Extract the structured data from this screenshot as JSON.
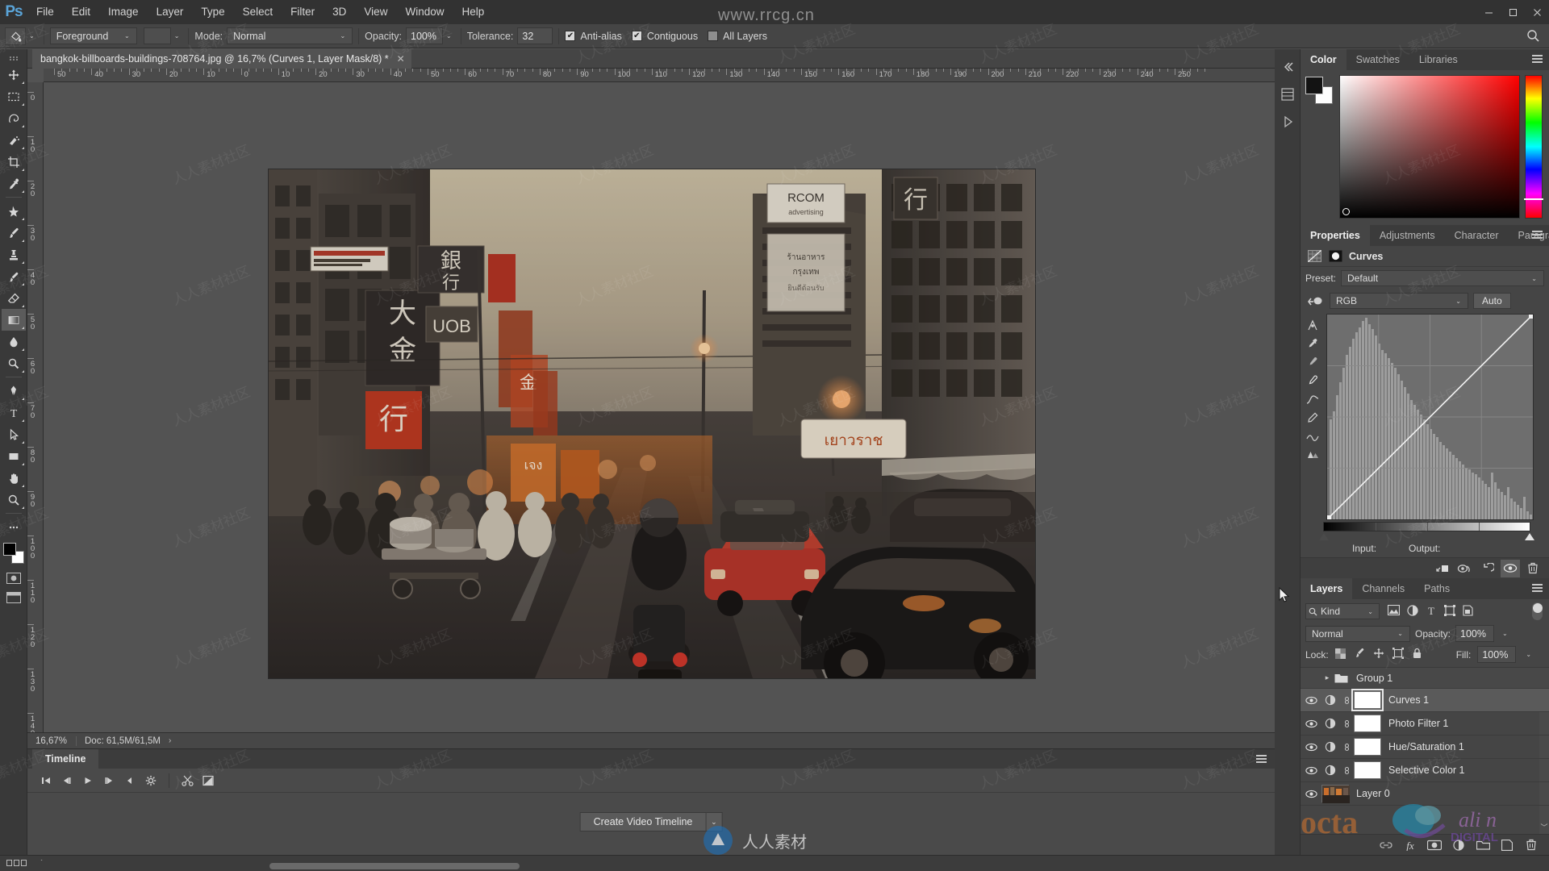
{
  "app": {
    "name": "Adobe Photoshop",
    "logo_text": "Ps"
  },
  "watermark": {
    "top": "www.rrcg.cn",
    "tile": "人人素材社区",
    "bottom": "人人素材"
  },
  "menubar": {
    "items": [
      "File",
      "Edit",
      "Image",
      "Layer",
      "Type",
      "Select",
      "Filter",
      "3D",
      "View",
      "Window",
      "Help"
    ],
    "window_controls": {
      "minimize": "—",
      "maximize": "❐",
      "close": "✕"
    }
  },
  "options_bar": {
    "tool_icon": "paint-bucket-icon",
    "fill_source": "Foreground",
    "mode_label": "Mode:",
    "mode_value": "Normal",
    "opacity_label": "Opacity:",
    "opacity_value": "100%",
    "tolerance_label": "Tolerance:",
    "tolerance_value": "32",
    "anti_alias": {
      "label": "Anti-alias",
      "checked": true
    },
    "contiguous": {
      "label": "Contiguous",
      "checked": true
    },
    "all_layers": {
      "label": "All Layers",
      "checked": false
    },
    "search_icon": "search-icon"
  },
  "document": {
    "tab_title": "bangkok-billboards-buildings-708764.jpg @ 16,7% (Curves 1, Layer Mask/8) *",
    "close_glyph": "✕"
  },
  "rulers": {
    "unit": "cm",
    "top_labels": [
      "50",
      "40",
      "30",
      "20",
      "10",
      "0",
      "10",
      "20",
      "30",
      "40",
      "50",
      "60",
      "70",
      "80",
      "90",
      "100",
      "110",
      "120",
      "130",
      "140",
      "150",
      "160",
      "170",
      "180",
      "190",
      "200",
      "210",
      "220",
      "230",
      "240",
      "250"
    ],
    "left_labels": [
      "0",
      "10",
      "20",
      "30",
      "40",
      "50",
      "60",
      "70",
      "80",
      "90",
      "100",
      "110",
      "120",
      "130",
      "140"
    ]
  },
  "status_bar": {
    "zoom": "16,67%",
    "doc_label": "Doc: 61,5M/61,5M",
    "expand_glyph": "›"
  },
  "timeline": {
    "tab_label": "Timeline",
    "buttons": [
      {
        "name": "go-to-first-frame-button",
        "glyph": "|◀"
      },
      {
        "name": "previous-frame-button",
        "glyph": "◀|"
      },
      {
        "name": "play-button",
        "glyph": "▶"
      },
      {
        "name": "next-frame-button",
        "glyph": "|▶"
      },
      {
        "name": "audio-button",
        "glyph": "◀"
      },
      {
        "name": "settings-gear-button",
        "glyph": "⚙"
      },
      {
        "name": "split-clip-button",
        "glyph": "✂"
      },
      {
        "name": "transition-button",
        "glyph": "◪"
      }
    ],
    "create_button": "Create Video Timeline",
    "create_caret": "⌄",
    "panel_menu": "hamburger-icon"
  },
  "color_panel": {
    "tabs": [
      "Color",
      "Swatches",
      "Libraries"
    ],
    "active_tab": "Color",
    "foreground_hex": "#131313",
    "background_hex": "#fdfdfd",
    "menu": "hamburger-icon"
  },
  "properties_panel": {
    "tabs": [
      "Properties",
      "Adjustments",
      "Character",
      "Paragraph"
    ],
    "active_tab": "Properties",
    "adjustment_title": "Curves",
    "preset_label": "Preset:",
    "preset_value": "Default",
    "channel_value": "RGB",
    "auto_button": "Auto",
    "input_label": "Input:",
    "output_label": "Output:",
    "input_value": "",
    "output_value": "",
    "curve_tools": [
      "on-image-adjust-icon",
      "black-point-eyedropper-icon",
      "gray-point-eyedropper-icon",
      "white-point-eyedropper-icon",
      "curve-pencil-icon",
      "draw-curve-icon",
      "smooth-curve-icon",
      "curve-display-icon"
    ],
    "footer_buttons": [
      "clip-to-layer-icon",
      "view-previous-state-icon",
      "reset-icon",
      "toggle-visibility-icon",
      "delete-icon"
    ]
  },
  "layers_panel": {
    "tabs": [
      "Layers",
      "Channels",
      "Paths"
    ],
    "active_tab": "Layers",
    "filter_label": "Kind",
    "filter_icon": "search-icon",
    "filter_type_icons": [
      "pixel-layer-filter-icon",
      "adjustment-layer-filter-icon",
      "type-layer-filter-icon",
      "shape-layer-filter-icon",
      "smart-object-filter-icon"
    ],
    "blend_mode": "Normal",
    "opacity_label": "Opacity:",
    "opacity_value": "100%",
    "lock_label": "Lock:",
    "lock_icons": [
      "lock-transparent-pixels-icon",
      "lock-image-pixels-icon",
      "lock-position-icon",
      "lock-artboard-icon",
      "lock-all-icon"
    ],
    "fill_label": "Fill:",
    "fill_value": "100%",
    "rows": [
      {
        "name": "Group 1",
        "type": "group",
        "visible": false,
        "selected": false,
        "expanded": false
      },
      {
        "name": "Curves 1",
        "type": "adjustment",
        "visible": true,
        "selected": true
      },
      {
        "name": "Photo Filter 1",
        "type": "adjustment",
        "visible": true,
        "selected": false
      },
      {
        "name": "Hue/Saturation 1",
        "type": "adjustment",
        "visible": true,
        "selected": false
      },
      {
        "name": "Selective Color 1",
        "type": "adjustment",
        "visible": true,
        "selected": false
      },
      {
        "name": "Layer 0",
        "type": "pixel",
        "visible": true,
        "selected": false
      }
    ],
    "footer_buttons": [
      "link-layers-icon",
      "layer-style-fx-icon",
      "add-layer-mask-icon",
      "new-adjustment-layer-icon",
      "new-group-icon",
      "new-layer-icon",
      "delete-layer-icon"
    ]
  },
  "dock_rail": {
    "icons": [
      "collapse-panels-icon",
      "history-icon",
      "actions-icon"
    ]
  },
  "toolbar": {
    "tools": [
      {
        "name": "move-tool",
        "active": false
      },
      {
        "name": "rectangular-marquee-tool",
        "active": false
      },
      {
        "name": "lasso-tool",
        "active": false
      },
      {
        "name": "quick-selection-tool",
        "active": false
      },
      {
        "name": "crop-tool",
        "active": false
      },
      {
        "name": "eyedropper-tool",
        "active": false
      },
      {
        "name": "spot-healing-brush-tool",
        "active": false
      },
      {
        "name": "brush-tool",
        "active": false
      },
      {
        "name": "clone-stamp-tool",
        "active": false
      },
      {
        "name": "history-brush-tool",
        "active": false
      },
      {
        "name": "eraser-tool",
        "active": false
      },
      {
        "name": "gradient-tool",
        "active": true
      },
      {
        "name": "blur-tool",
        "active": false
      },
      {
        "name": "dodge-tool",
        "active": false
      },
      {
        "name": "pen-tool",
        "active": false
      },
      {
        "name": "type-tool",
        "active": false
      },
      {
        "name": "path-selection-tool",
        "active": false
      },
      {
        "name": "rectangle-tool",
        "active": false
      },
      {
        "name": "hand-tool",
        "active": false
      },
      {
        "name": "zoom-tool",
        "active": false
      }
    ],
    "foreground_color": "#000000",
    "background_color": "#ffffff"
  },
  "canvas": {
    "image_title": "bangkok street scene with billboards and traffic",
    "zoom_percent": "16,67%"
  }
}
